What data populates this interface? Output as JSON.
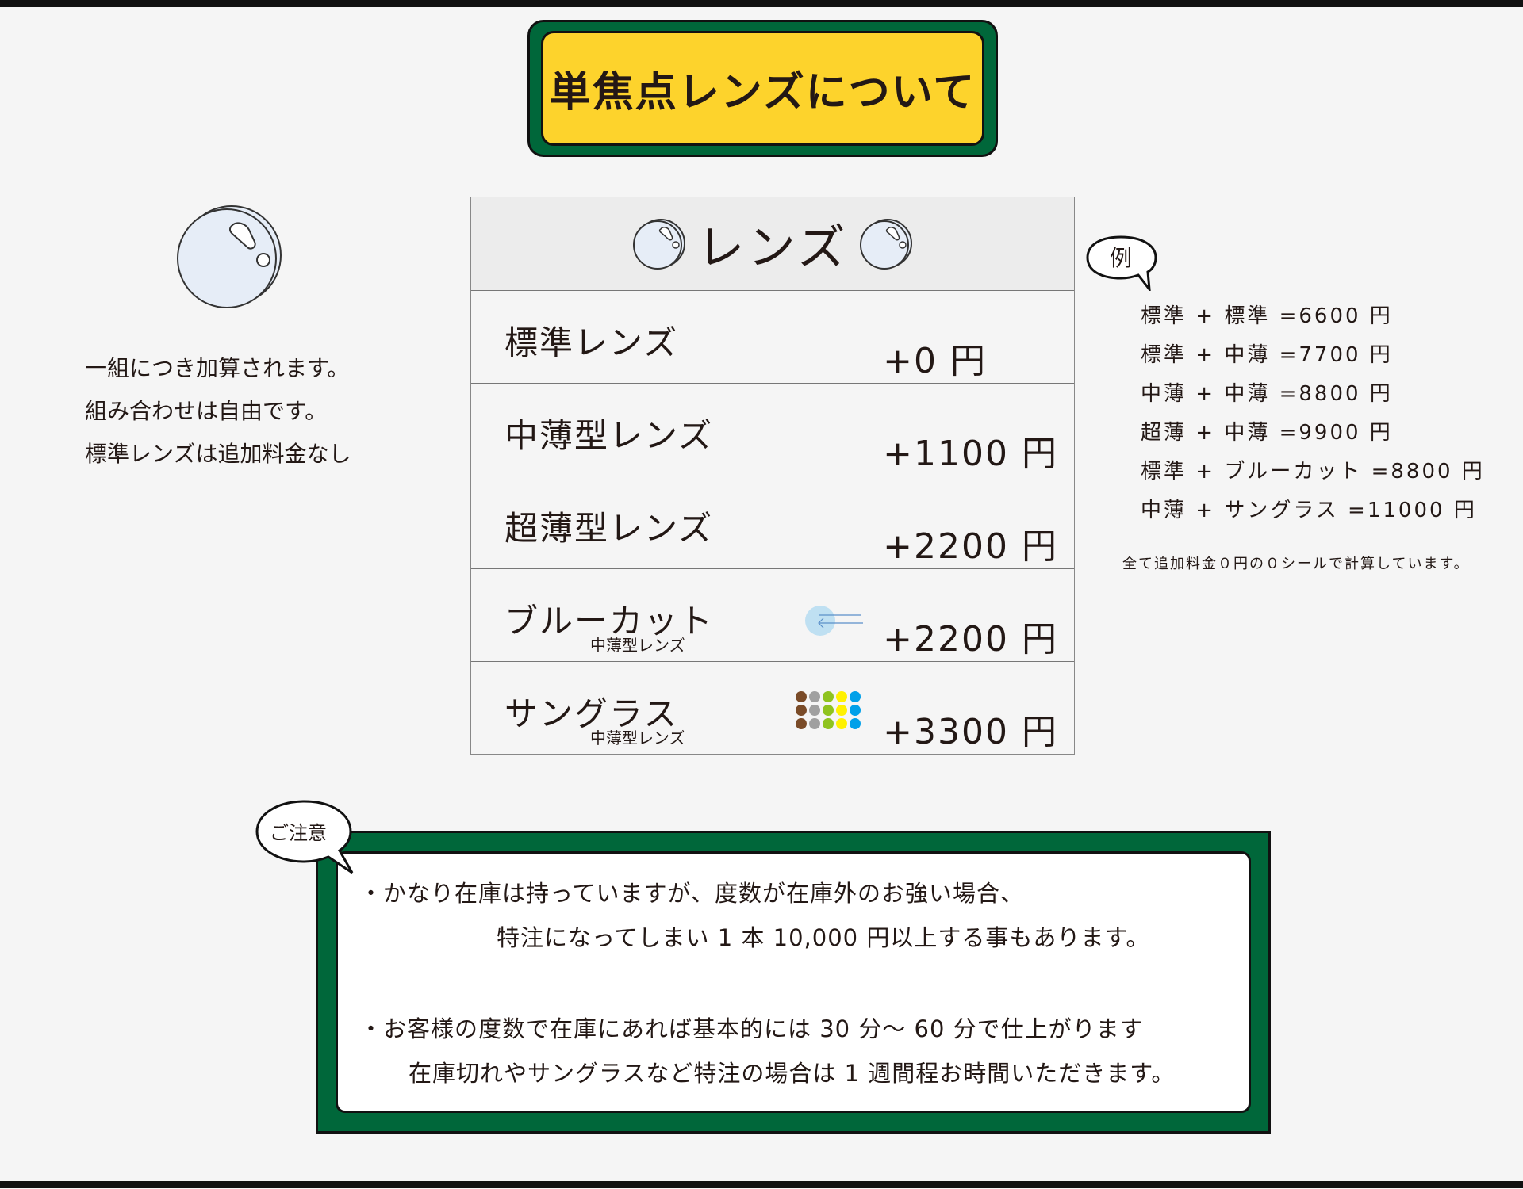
{
  "title": "単焦点レンズについて",
  "left_notes": [
    "一組につき加算されます。",
    "組み合わせは自由です。",
    "標準レンズは追加料金なし"
  ],
  "table": {
    "header": "レンズ",
    "rows": [
      {
        "name": "標準レンズ",
        "sub": "",
        "price": "+0 円"
      },
      {
        "name": "中薄型レンズ",
        "sub": "",
        "price": "+1100 円"
      },
      {
        "name": "超薄型レンズ",
        "sub": "",
        "price": "+2200 円"
      },
      {
        "name": "ブルーカット",
        "sub": "中薄型レンズ",
        "price": "+2200 円"
      },
      {
        "name": "サングラス",
        "sub": "中薄型レンズ",
        "price": "+3300 円"
      }
    ]
  },
  "examples": {
    "bubble_label": "例",
    "lines": [
      "標準 + 標準 =6600 円",
      "標準 + 中薄 =7700 円",
      "中薄 + 中薄 =8800 円",
      "超薄 + 中薄 =9900 円",
      "標準 + ブルーカット =8800 円",
      "中薄 + サングラス =11000 円"
    ],
    "note": "全て追加料金０円の０シールで計算しています。"
  },
  "notice": {
    "bubble_label": "ご注意",
    "lines": [
      "・かなり在庫は持っていますが、度数が在庫外のお強い場合、",
      "特注になってしまい 1 本 10,000 円以上する事もあります。",
      "・お客様の度数で在庫にあれば基本的には 30 分～ 60 分で仕上がります",
      "在庫切れやサングラスなど特注の場合は 1 週間程お時間いただきます。"
    ]
  },
  "colors": {
    "green": "#00673a",
    "yellow": "#fdd32c",
    "text": "#231815",
    "lens_fill": "#e6edf7",
    "bluecut": "#bfe0f2",
    "sunglass_dots": [
      "#7a4b28",
      "#a0a0a0",
      "#8fc31f",
      "#fff100",
      "#00a0e9"
    ]
  },
  "icons": {
    "lens": "lens-icon",
    "bluecut": "bluecut-light-icon",
    "sunglass": "color-dots-icon"
  }
}
